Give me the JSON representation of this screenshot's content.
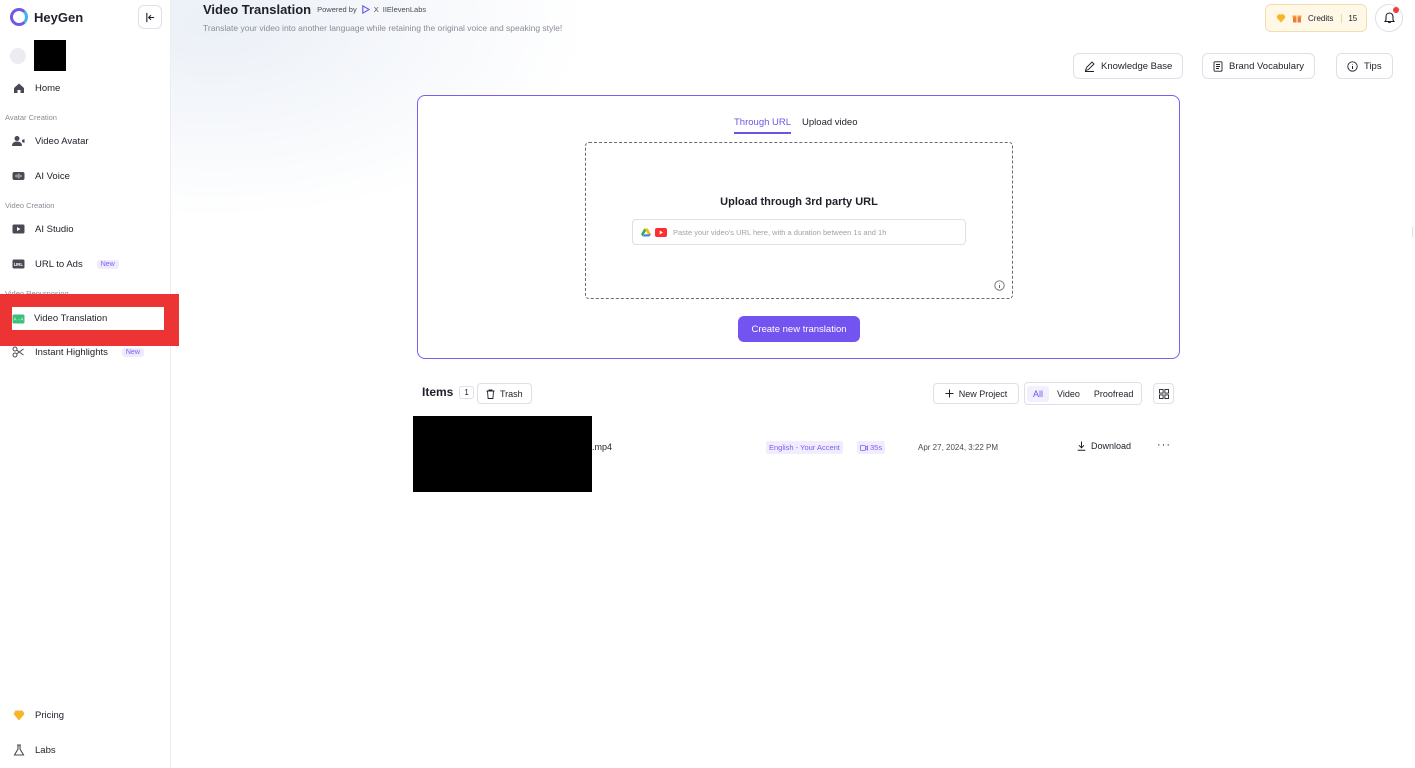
{
  "sidebar": {
    "brand": "HeyGen",
    "items": {
      "home": "Home",
      "video_avatar": "Video Avatar",
      "ai_voice": "AI Voice",
      "ai_studio": "AI Studio",
      "url_to_ads": "URL to Ads",
      "video_translation": "Video Translation",
      "instant_highlights": "Instant Highlights",
      "pricing": "Pricing",
      "labs": "Labs"
    },
    "sections": {
      "avatar_creation": "Avatar Creation",
      "video_creation": "Video Creation",
      "video_repurposing": "Video Repurposing"
    },
    "new_badge": "New"
  },
  "header": {
    "title": "Video Translation",
    "powered_by": "Powered by",
    "x": "X",
    "partner": "IIElevenLabs",
    "subtitle": "Translate your video into another language while retaining the original voice and speaking style!",
    "credits_label": "Credits",
    "credits_value": "15"
  },
  "toolbar": {
    "knowledge_base": "Knowledge Base",
    "brand_vocabulary": "Brand Vocabulary",
    "tips": "Tips"
  },
  "upload": {
    "tabs": [
      "Through URL",
      "Upload video"
    ],
    "active_tab": "Through URL",
    "title": "Upload through 3rd party URL",
    "url_placeholder": "Paste your video's URL here, with a duration between 1s and 1h",
    "create_button": "Create new translation"
  },
  "items": {
    "title": "Items",
    "count": "1",
    "trash": "Trash",
    "new_project": "New Project",
    "filters": [
      "All",
      "Video",
      "Proofread"
    ],
    "active_filter": "All",
    "rows": [
      {
        "filename": ".mp4",
        "language": "English - Your Accent",
        "duration": "35s",
        "date": "Apr 27, 2024, 3:22 PM",
        "download": "Download",
        "more": "···"
      }
    ]
  },
  "colors": {
    "accent": "#7354f0",
    "highlight": "#ec3434",
    "credits_bg": "#fff8e6"
  }
}
